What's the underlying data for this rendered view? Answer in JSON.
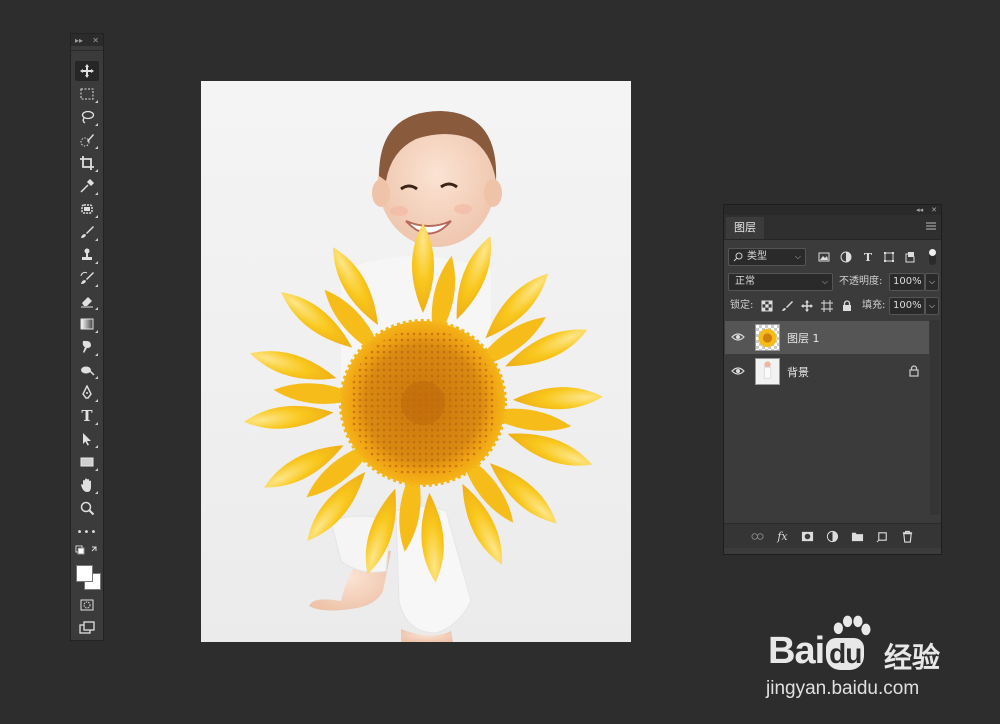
{
  "toolbar": {
    "tools": [
      "move-tool",
      "rectangular-marquee-tool",
      "lasso-tool",
      "quick-selection-tool",
      "crop-tool",
      "eyedropper-tool",
      "spot-healing-tool",
      "brush-tool",
      "clone-stamp-tool",
      "history-brush-tool",
      "eraser-tool",
      "gradient-tool",
      "smudge-tool",
      "dodge-tool",
      "pen-tool",
      "type-tool",
      "path-selection-tool",
      "rectangle-tool",
      "hand-tool",
      "zoom-tool",
      "edit-toolbar",
      "default-colors",
      "foreground-background-color",
      "quick-mask",
      "screen-mode"
    ],
    "type_tool_glyph": "T",
    "more_glyph": "•••"
  },
  "layers_panel": {
    "tab_label": "图层",
    "filter_kind": "类型",
    "blend_mode": "正常",
    "opacity_label": "不透明度:",
    "opacity_value": "100%",
    "lock_label": "锁定:",
    "fill_label": "填充:",
    "fill_value": "100%",
    "layers": [
      {
        "name": "图层 1",
        "selected": true,
        "visible": true,
        "locked": false
      },
      {
        "name": "背景",
        "selected": false,
        "visible": true,
        "locked": true
      }
    ],
    "bottom_fx_label": "fx"
  },
  "watermark": {
    "brand": "Bai",
    "brand_du": "du",
    "cn_text": "经验",
    "url": "jingyan.baidu.com"
  },
  "colors": {
    "app_background": "#2d2d2d",
    "panel_background": "#3b3b3b",
    "selected_layer": "#555555",
    "sunflower_petal": "#f7c21a",
    "sunflower_center": "#d98a12"
  }
}
